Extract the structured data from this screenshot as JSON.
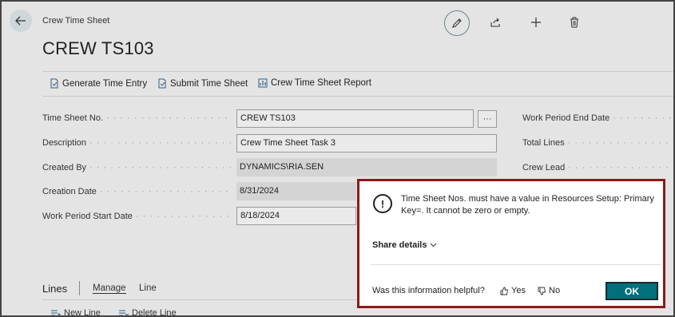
{
  "header": {
    "caption": "Crew Time Sheet",
    "title": "CREW TS103"
  },
  "toolbar": {
    "generate": "Generate Time Entry",
    "submit": "Submit Time Sheet",
    "report": "Crew Time Sheet Report"
  },
  "fields": {
    "time_sheet_no": {
      "label": "Time Sheet No.",
      "value": "CREW TS103"
    },
    "description": {
      "label": "Description",
      "value": "Crew Time Sheet Task 3"
    },
    "created_by": {
      "label": "Created By",
      "value": "DYNAMICS\\RIA.SEN"
    },
    "creation_date": {
      "label": "Creation Date",
      "value": "8/31/2024"
    },
    "work_period_start": {
      "label": "Work Period Start Date",
      "value": "8/18/2024"
    },
    "ellipsis": "···"
  },
  "right_fields": {
    "end_date": "Work Period End Date",
    "total_lines": "Total Lines",
    "crew_lead": "Crew Lead"
  },
  "lines": {
    "title": "Lines",
    "tabs": [
      "Manage",
      "Line"
    ],
    "actions": [
      "New Line",
      "Delete Line"
    ]
  },
  "dialog": {
    "message": "Time Sheet Nos. must have a value in Resources Setup: Primary Key=. It cannot be zero or empty.",
    "share": "Share details",
    "helpful": "Was this information helpful?",
    "yes": "Yes",
    "no": "No",
    "ok": "OK"
  },
  "colors": {
    "dialog_border": "#8b1a1a",
    "ok_button": "#00707c"
  }
}
